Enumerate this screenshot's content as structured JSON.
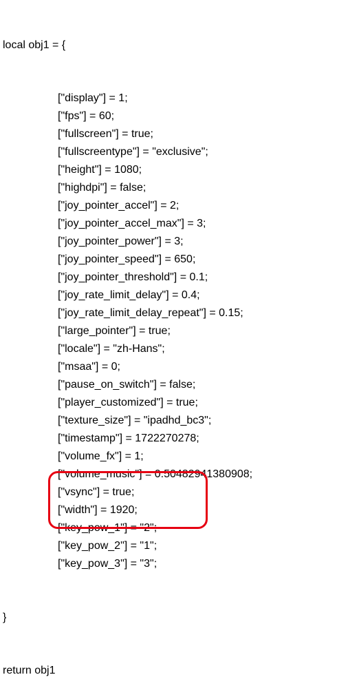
{
  "header_line": "local obj1 = {",
  "entries": [
    {
      "key": "display",
      "value": "1",
      "quoted": false
    },
    {
      "key": "fps",
      "value": "60",
      "quoted": false
    },
    {
      "key": "fullscreen",
      "value": "true",
      "quoted": false
    },
    {
      "key": "fullscreentype",
      "value": "exclusive",
      "quoted": true
    },
    {
      "key": "height",
      "value": "1080",
      "quoted": false
    },
    {
      "key": "highdpi",
      "value": "false",
      "quoted": false
    },
    {
      "key": "joy_pointer_accel",
      "value": "2",
      "quoted": false
    },
    {
      "key": "joy_pointer_accel_max",
      "value": "3",
      "quoted": false
    },
    {
      "key": "joy_pointer_power",
      "value": "3",
      "quoted": false
    },
    {
      "key": "joy_pointer_speed",
      "value": "650",
      "quoted": false
    },
    {
      "key": "joy_pointer_threshold",
      "value": "0.1",
      "quoted": false
    },
    {
      "key": "joy_rate_limit_delay",
      "value": "0.4",
      "quoted": false
    },
    {
      "key": "joy_rate_limit_delay_repeat",
      "value": "0.15",
      "quoted": false
    },
    {
      "key": "large_pointer",
      "value": "true",
      "quoted": false
    },
    {
      "key": "locale",
      "value": "zh-Hans",
      "quoted": true
    },
    {
      "key": "msaa",
      "value": "0",
      "quoted": false
    },
    {
      "key": "pause_on_switch",
      "value": "false",
      "quoted": false
    },
    {
      "key": "player_customized",
      "value": "true",
      "quoted": false
    },
    {
      "key": "texture_size",
      "value": "ipadhd_bc3",
      "quoted": true
    },
    {
      "key": "timestamp",
      "value": "1722270278",
      "quoted": false
    },
    {
      "key": "volume_fx",
      "value": "1",
      "quoted": false
    },
    {
      "key": "volume_music",
      "value": "0.50482941380908",
      "quoted": false
    },
    {
      "key": "vsync",
      "value": "true",
      "quoted": false
    },
    {
      "key": "width",
      "value": "1920",
      "quoted": false
    },
    {
      "key": "key_pow_1",
      "value": "2",
      "quoted": true
    },
    {
      "key": "key_pow_2",
      "value": "1",
      "quoted": true
    },
    {
      "key": "key_pow_3",
      "value": "3",
      "quoted": true
    }
  ],
  "close_line": "}",
  "return_line": "return obj1",
  "highlighted_keys": [
    "key_pow_1",
    "key_pow_2",
    "key_pow_3"
  ]
}
